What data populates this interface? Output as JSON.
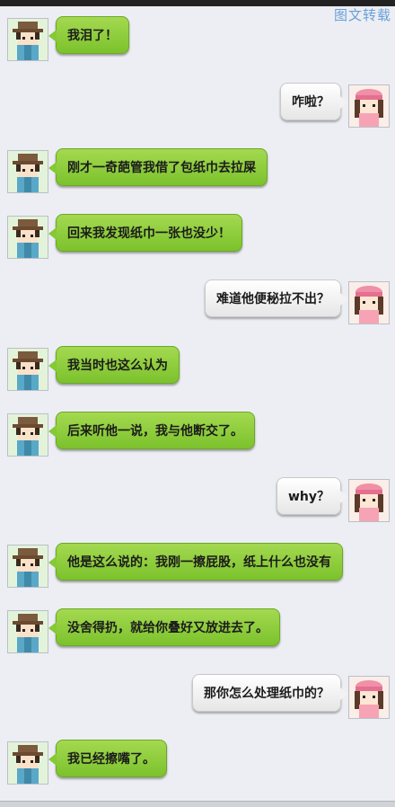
{
  "watermark": "图文转载",
  "messages": [
    {
      "side": "left",
      "text": "我泪了！"
    },
    {
      "side": "right",
      "text": "咋啦？"
    },
    {
      "side": "left",
      "text": "刚才一奇葩管我借了包纸巾去拉屎"
    },
    {
      "side": "left",
      "text": "回来我发现纸巾一张也没少！"
    },
    {
      "side": "right",
      "text": "难道他便秘拉不出？"
    },
    {
      "side": "left",
      "text": "我当时也这么认为"
    },
    {
      "side": "left",
      "text": "后来听他一说，我与他断交了。"
    },
    {
      "side": "right",
      "text": "why？"
    },
    {
      "side": "left",
      "text": "他是这么说的：我刚一擦屁股，纸上什么也没有"
    },
    {
      "side": "left",
      "text": "没舍得扔，就给你叠好又放进去了。"
    },
    {
      "side": "right",
      "text": "那你怎么处理纸巾的？"
    },
    {
      "side": "left",
      "text": "我已经擦嘴了。"
    }
  ],
  "colors": {
    "left_bubble": "#8ccd3c",
    "right_bubble": "#f2f2f2",
    "background": "#eceef3"
  }
}
